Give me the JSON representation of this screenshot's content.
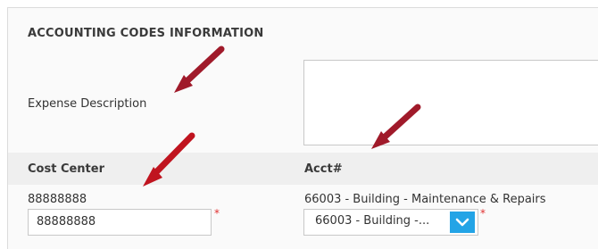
{
  "section": {
    "title": "ACCOUNTING CODES INFORMATION"
  },
  "expense": {
    "label": "Expense Description",
    "value": ""
  },
  "table": {
    "headers": [
      "Cost Center",
      "Acct#"
    ],
    "cost_center": {
      "value_text": "88888888",
      "input_value": "88888888",
      "required_mark": "*"
    },
    "acct": {
      "value_text": "66003 - Building - Maintenance & Repairs",
      "selected_label": "66003 - Building -...",
      "required_mark": "*"
    }
  },
  "colors": {
    "accent": "#23a4e6",
    "required": "#e03030",
    "annotation_arrow": "#b3121f"
  },
  "icons": {
    "dropdown": "chevron-down-icon",
    "annotation": "arrow-icon"
  }
}
